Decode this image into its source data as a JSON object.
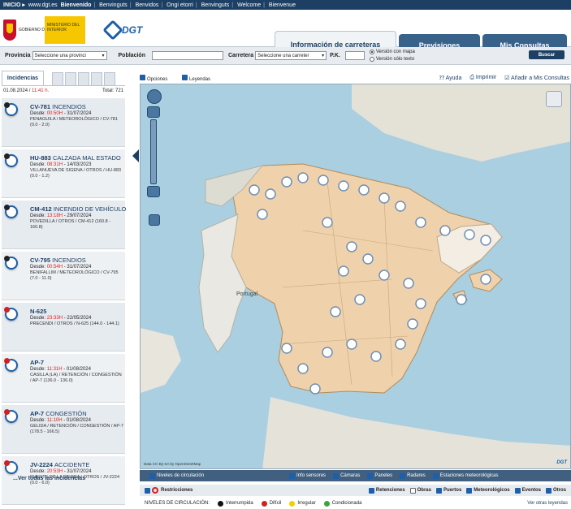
{
  "topbar": {
    "home": "INICIO ▸",
    "url": "www.dgt.es",
    "langs": [
      "Bienvenido",
      "Benvinguts",
      "Benvidos",
      "Ongi etorri",
      "Benvinguts",
      "Welcome",
      "Bienvenue"
    ]
  },
  "header": {
    "gov_text": "GOBIERNO DE ESPAÑA",
    "ministry_text": "MINISTERIO DEL INTERIOR",
    "dgt_logo": "DGT",
    "tabs": [
      {
        "label": "Información de carreteras",
        "active": true
      },
      {
        "label": "Previsiones",
        "active": false
      },
      {
        "label": "Mis Consultas",
        "active": false
      }
    ]
  },
  "search": {
    "provincia_label": "Provincia",
    "provincia_value": "Seleccione una provinci",
    "poblacion_label": "Población",
    "carretera_label": "Carretera",
    "carretera_value": "Seleccione una carreter",
    "pk_label": "P.K.",
    "radio_map": "Versión con mapa",
    "radio_text": "Versión sólo texto",
    "button": "Buscar"
  },
  "sidebar": {
    "tab_label": "Incidencias",
    "date": "01.08.2024",
    "time": "11:41 h.",
    "total": "Total: 721",
    "see_all": "...Ver todas las incidencias",
    "incidents": [
      {
        "road": "CV-781",
        "type": "INCENDIOS",
        "since_label": "Desde:",
        "since_time": "00:50H",
        "since_date": "- 31/07/2024",
        "desc": "PENAGUILA / METEOROLÓGICO / CV-781 (0.0 - 2.0)",
        "icon": "black"
      },
      {
        "road": "HU-883",
        "type": "CALZADA MAL ESTADO",
        "since_label": "Desde:",
        "since_time": "08:31H",
        "since_date": "- 14/03/2023",
        "desc": "VILLANUEVA DE SIGENA / OTROS / HU-883 (0.0 - 1.2)",
        "icon": "black"
      },
      {
        "road": "CM-412",
        "type": "INCENDIO DE VEHÍCULO",
        "since_label": "Desde:",
        "since_time": "13:18H",
        "since_date": "- 29/07/2024",
        "desc": "POVEDILLA / OTROS / CM-412 (160.8 - 160.8)",
        "icon": "black"
      },
      {
        "road": "CV-795",
        "type": "INCENDIOS",
        "since_label": "Desde:",
        "since_time": "00:54H",
        "since_date": "- 31/07/2024",
        "desc": "BENIFALLIM / METEOROLÓGICO / CV-795 (7.0 - 11.0)",
        "icon": "black"
      },
      {
        "road": "N-625",
        "type": "",
        "since_label": "Desde:",
        "since_time": "23:33H",
        "since_date": "- 22/05/2024",
        "desc": "PRECENDI / OTROS / N-625 (144.0 - 144.1)",
        "icon": "red"
      },
      {
        "road": "AP-7",
        "type": "",
        "since_label": "Desde:",
        "since_time": "11:31H",
        "since_date": "- 01/08/2024",
        "desc": "CASILLA (LA) / RETENCIÓN / CONGESTIÓN / AP-7 (136.0 - 136.0)",
        "icon": "red"
      },
      {
        "road": "AP-7",
        "type": "CONGESTIÓN",
        "since_label": "Desde:",
        "since_time": "11:10H",
        "since_date": "- 01/08/2024",
        "desc": "GELIDA / RETENCIÓN / CONGESTIÓN / AP-7 (178.5 - 166.5)",
        "icon": "red"
      },
      {
        "road": "JV-2224",
        "type": "ACCIDENTE",
        "since_label": "Desde:",
        "since_time": "20:53H",
        "since_date": "- 31/07/2024",
        "desc": "PUENTE DE LA SIERRA / OTROS / JV-2224 (0.0 - 6.0)",
        "icon": "red"
      }
    ]
  },
  "map_tools": {
    "opciones": "Opciones",
    "leyendas": "Leyendas",
    "ayuda": "Ayuda",
    "imprimir": "Imprimir",
    "add": "Añadir a Mis Consultas"
  },
  "map": {
    "label_portugal": "Portugal",
    "attribution": "Data CC-By-SA by OpenStreetMap",
    "corner": "DGT"
  },
  "legend": {
    "row1": [
      "Niveles de circulación",
      "Info sensores",
      "Cámaras",
      "Paneles",
      "Radares",
      "Estaciones meteorológicas"
    ],
    "restricciones": "Restricciones",
    "row2": [
      "Retenciones",
      "Obras",
      "Puertos",
      "Meteorológicos",
      "Eventos",
      "Otros"
    ],
    "niveles_label": "NIVELES DE CIRCULACIÓN:",
    "niveles": [
      {
        "label": "Interrumpida",
        "color": "#111111"
      },
      {
        "label": "Difícil",
        "color": "#d31f1f"
      },
      {
        "label": "Irregular",
        "color": "#f2d000"
      },
      {
        "label": "Condicionada",
        "color": "#3aa63a"
      }
    ],
    "more": "Ver otras leyendas"
  }
}
